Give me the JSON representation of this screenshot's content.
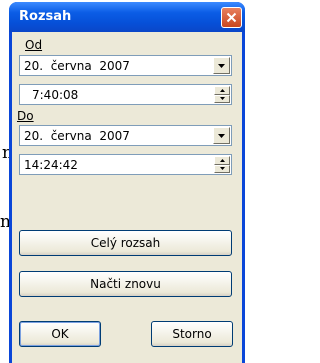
{
  "background": {
    "fragment_1": "n",
    "fragment_2": "ní"
  },
  "dialog": {
    "title": "Rozsah",
    "from": {
      "label": "Od",
      "date": "20.  června  2007",
      "time": "7:40:08"
    },
    "to": {
      "label": "Do",
      "date": "20.  června  2007",
      "time": "14:24:42"
    },
    "buttons": {
      "full_range": "Celý rozsah",
      "reload": "Načti znovu",
      "ok": "OK",
      "cancel": "Storno"
    }
  },
  "colors": {
    "titlebar": "#0b5de6",
    "client": "#ece9d8",
    "close_button": "#c9461f"
  }
}
